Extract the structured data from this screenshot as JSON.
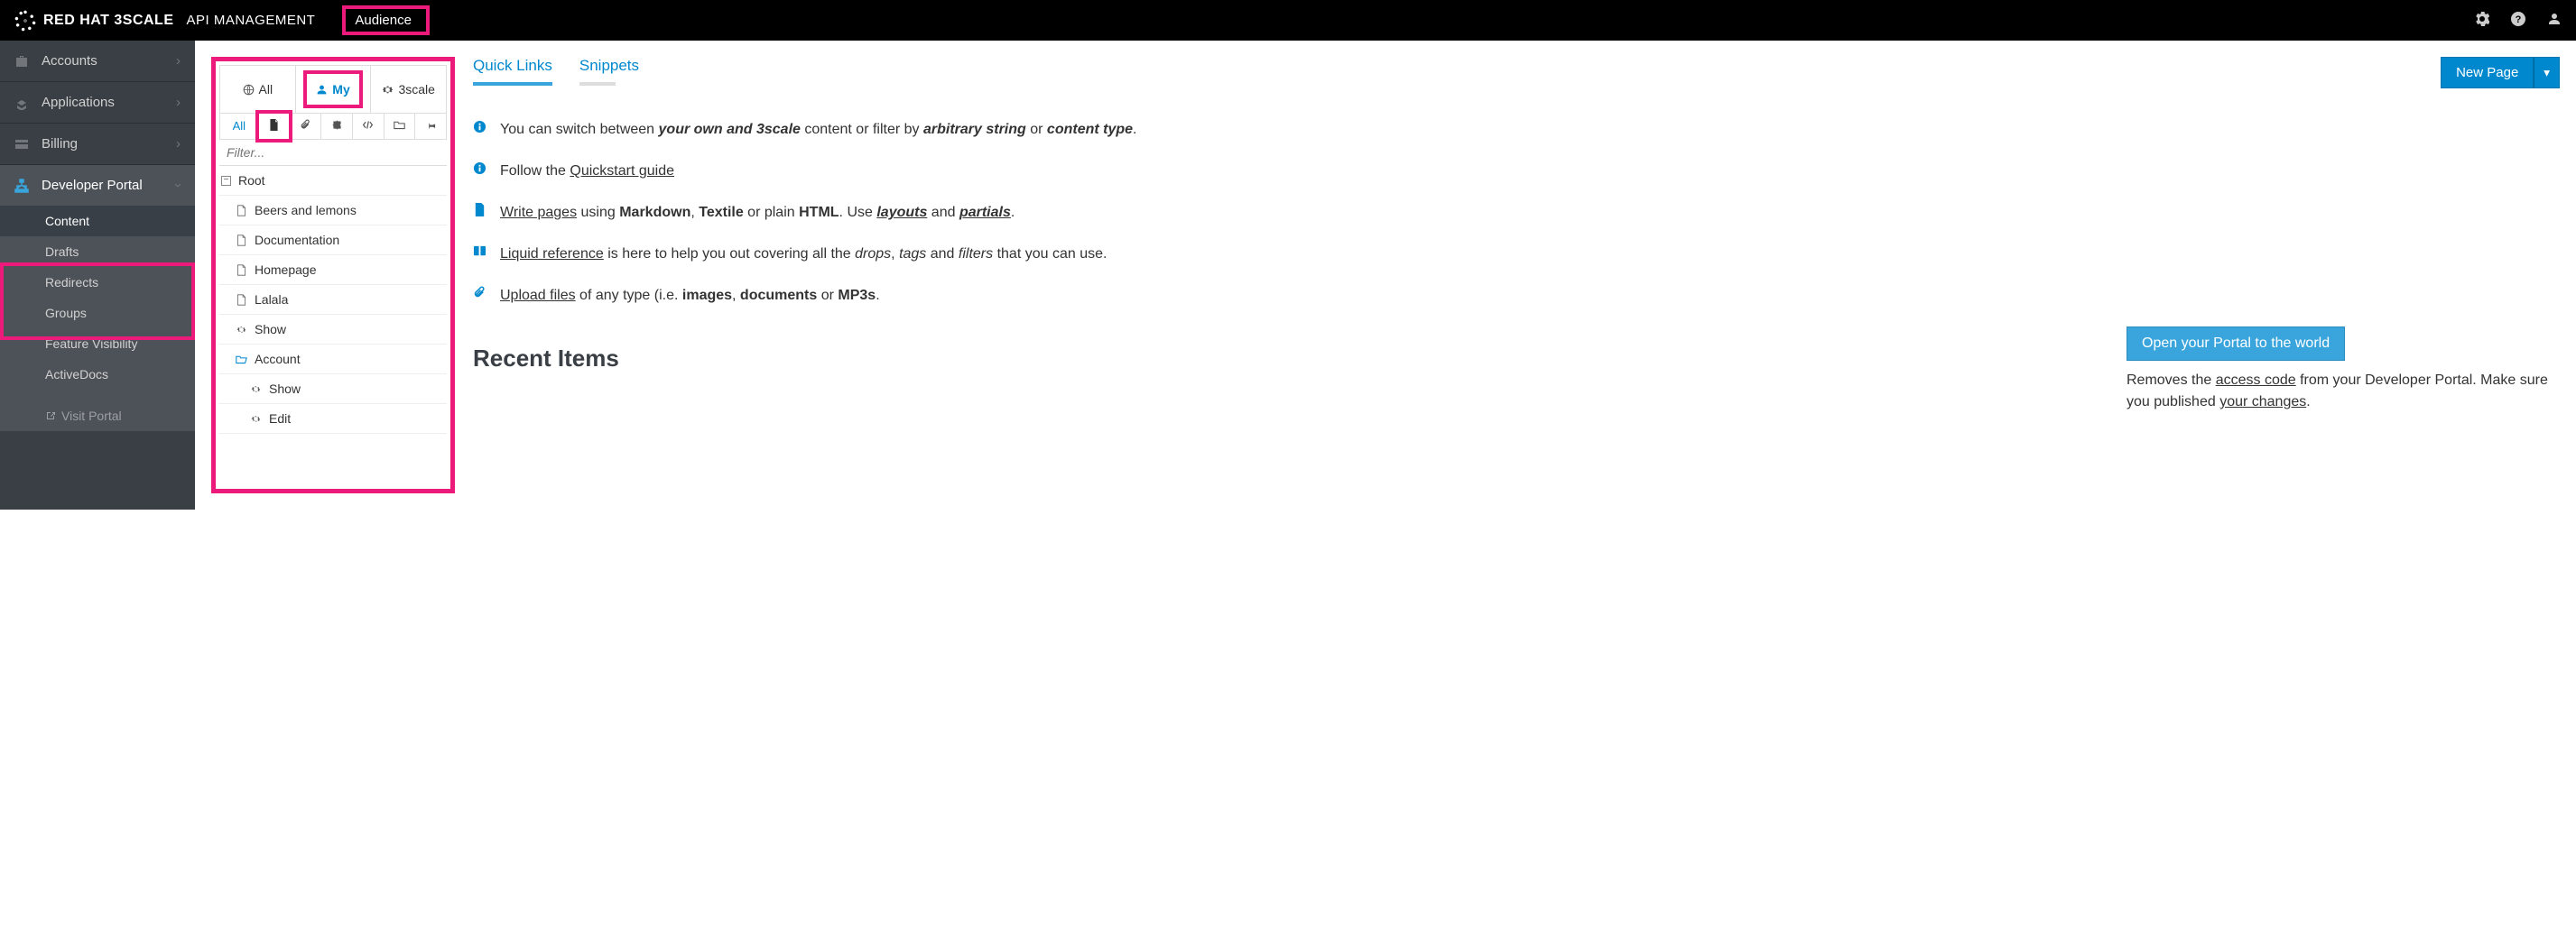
{
  "topbar": {
    "brand_main": "RED HAT 3SCALE",
    "brand_sub": "API MANAGEMENT",
    "context": "Audience"
  },
  "sidebar": {
    "items": [
      {
        "label": "Accounts"
      },
      {
        "label": "Applications"
      },
      {
        "label": "Billing"
      },
      {
        "label": "Developer Portal"
      }
    ],
    "devportal_sub": [
      {
        "label": "Content",
        "active": true
      },
      {
        "label": "Drafts"
      },
      {
        "label": "Redirects"
      },
      {
        "label": "Groups"
      },
      {
        "label": "Feature Visibility"
      },
      {
        "label": "ActiveDocs"
      }
    ],
    "visit_portal": "Visit Portal"
  },
  "tree": {
    "owner_tabs": {
      "all": "All",
      "my": "My",
      "threescale": "3scale"
    },
    "type_all": "All",
    "filter_placeholder": "Filter...",
    "root": "Root",
    "pages": [
      "Beers and lemons",
      "Documentation",
      "Homepage",
      "Lalala",
      "Show"
    ],
    "account_folder": "Account",
    "account_pages": [
      "Show",
      "Edit"
    ]
  },
  "content": {
    "tabs": {
      "quick_links": "Quick Links",
      "snippets": "Snippets"
    },
    "new_page": "New Page",
    "tips": {
      "switch_pre": "You can switch between ",
      "switch_own": "your own and 3scale",
      "switch_mid": " content or filter by ",
      "switch_str": "arbitrary string",
      "switch_or": " or ",
      "switch_type": "content type",
      "follow": "Follow the ",
      "quickstart": "Quickstart guide",
      "write_pages": "Write pages",
      "write_mid1": " using ",
      "markdown": "Markdown",
      "comma": ", ",
      "textile": "Textile",
      "or_plain": " or plain ",
      "html": "HTML",
      "use": ". Use ",
      "layouts": "layouts",
      "and": " and ",
      "partials": "partials",
      "period": ".",
      "liquid": "Liquid reference",
      "liquid_rest": " is here to help you out covering all the ",
      "drops": "drops",
      "tags": "tags",
      "filters": "filters",
      "liquid_tail": " that you can use.",
      "upload": "Upload files",
      "upload_mid": " of any type (i.e. ",
      "images": "images",
      "documents": "documents",
      "mp3s": "MP3s",
      "upload_end": "."
    },
    "recent_heading": "Recent Items",
    "open_portal": "Open your Portal to the world",
    "open_note_pre": "Removes the ",
    "access_code": "access code",
    "open_note_mid": " from your Developer Portal. Make sure you published ",
    "your_changes": "your changes",
    "open_note_end": "."
  }
}
